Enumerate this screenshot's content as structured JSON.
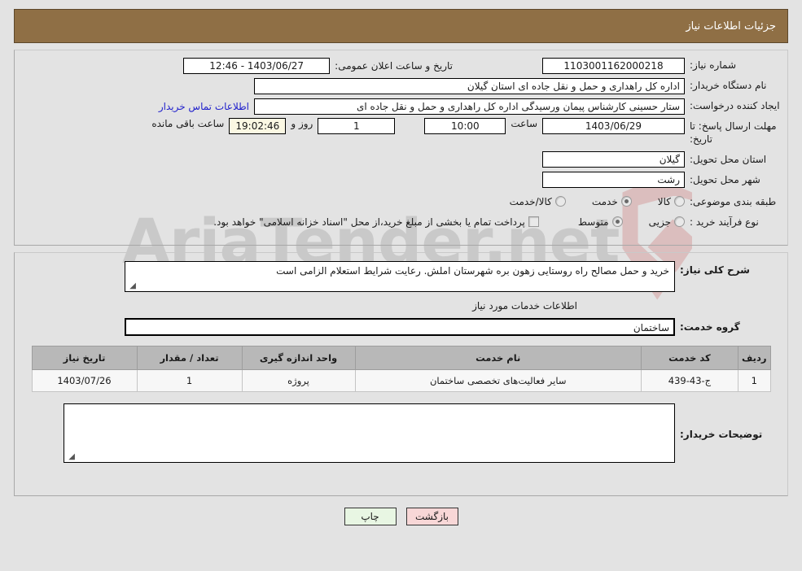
{
  "header": {
    "title": "جزئیات اطلاعات نیاز"
  },
  "watermark": {
    "text": "AriaTender.net"
  },
  "form": {
    "need_number": {
      "label": "شماره نیاز:",
      "value": "1103001162000218"
    },
    "announce_datetime": {
      "label": "تاریخ و ساعت اعلان عمومی:",
      "value": "1403/06/27 - 12:46"
    },
    "buyer_org": {
      "label": "نام دستگاه خریدار:",
      "value": "اداره کل راهداری و حمل و نقل جاده ای استان گیلان"
    },
    "request_creator": {
      "label": "ایجاد کننده درخواست:",
      "value": "ستار حسینی کارشناس پیمان ورسیدگی اداره کل راهداری و حمل و نقل جاده ای",
      "link": "اطلاعات تماس خریدار"
    },
    "deadline": {
      "label": "مهلت ارسال پاسخ: تا تاریخ:",
      "date": "1403/06/29",
      "time_label": "ساعت",
      "time": "10:00",
      "days": "1",
      "days_label": "روز و",
      "countdown": "19:02:46",
      "remaining_label": "ساعت باقی مانده"
    },
    "delivery_province": {
      "label": "استان محل تحویل:",
      "value": "گیلان"
    },
    "delivery_city": {
      "label": "شهر محل تحویل:",
      "value": "رشت"
    },
    "category": {
      "label": "طبقه بندی موضوعی:",
      "options": [
        {
          "label": "کالا",
          "selected": false
        },
        {
          "label": "خدمت",
          "selected": true
        },
        {
          "label": "کالا/خدمت",
          "selected": false
        }
      ]
    },
    "purchase_process": {
      "label": "نوع فرآیند خرید :",
      "options": [
        {
          "label": "جزیی",
          "selected": false
        },
        {
          "label": "متوسط",
          "selected": true
        }
      ],
      "checkbox_checked": false,
      "checkbox_text": "پرداخت تمام یا بخشی از مبلغ خرید،از محل \"اسناد خزانه اسلامی\" خواهد بود."
    }
  },
  "need_summary": {
    "label": "شرح کلی نیاز:",
    "value": "خرید و حمل مصالح راه روستایی زهون بره شهرستان املش. رعایت شرایط استعلام الزامی است"
  },
  "services_section": {
    "title": "اطلاعات خدمات مورد نیاز",
    "service_group": {
      "label": "گروه خدمت:",
      "value": "ساختمان"
    },
    "table": {
      "columns": [
        "ردیف",
        "کد خدمت",
        "نام خدمت",
        "واحد اندازه گیری",
        "تعداد / مقدار",
        "تاریخ نیاز"
      ],
      "rows": [
        {
          "radif": "1",
          "code": "ج-43-439",
          "name": "سایر فعالیت‌های تخصصی ساختمان",
          "unit": "پروژه",
          "quantity": "1",
          "need_date": "1403/07/26"
        }
      ]
    }
  },
  "buyer_notes": {
    "label": "توضیحات خریدار:",
    "value": ""
  },
  "footer": {
    "back_label": "بازگشت",
    "print_label": "چاپ"
  },
  "colors": {
    "header_bar": "#8f6f45",
    "page_background": "#e3e3e3",
    "link": "#2222cc",
    "back_button": "#f8d7d7",
    "print_button": "#e8f6e3",
    "countdown_field": "#fbf8e3",
    "table_header": "#b8b8b8"
  }
}
